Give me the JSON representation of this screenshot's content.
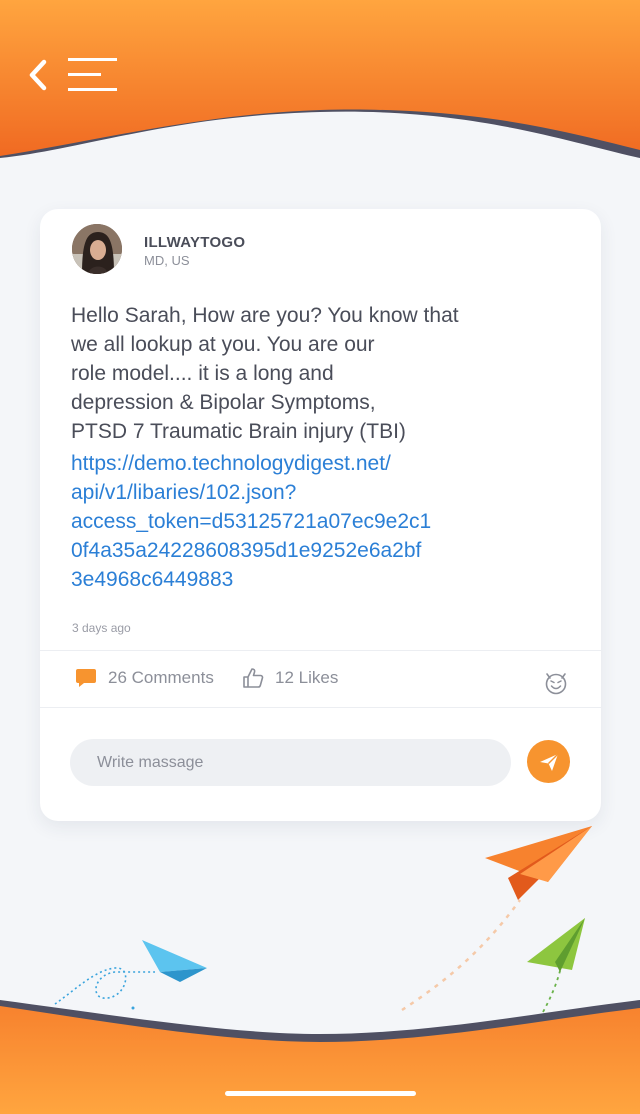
{
  "header": {
    "back_icon": "chevron-left-icon",
    "menu_icon": "menu-icon"
  },
  "post": {
    "author": {
      "username": "ILLWAYTOGO",
      "location": "MD, US"
    },
    "text": "Hello Sarah, How are you? You know that we all lookup at you. You are our role model.... it is a long and depression & Bipolar Symptoms, PTSD 7 Traumatic Brain injury (TBI)",
    "text_lines": [
      "Hello Sarah, How are you? You know that",
      "we all lookup at you. You are our",
      "role model.... it is a long and",
      "depression & Bipolar Symptoms,",
      "PTSD 7 Traumatic Brain injury (TBI)"
    ],
    "link_lines": [
      "https://demo.technologydigest.net/",
      "api/v1/libaries/102.json?",
      "access_token=d53125721a07ec9e2c1",
      "0f4a35a24228608395d1e9252e6a2bf",
      "3e4968c6449883"
    ],
    "timestamp": "3 days ago",
    "comments_label": "26 Comments",
    "likes_label": "12 Likes"
  },
  "composer": {
    "placeholder": "Write massage"
  },
  "colors": {
    "accent": "#f7942f",
    "header_top": "#ffa53f",
    "header_bottom": "#f06a22",
    "wave_dark": "#4f5063",
    "link": "#2b7fd6",
    "text": "#4a4d59"
  }
}
